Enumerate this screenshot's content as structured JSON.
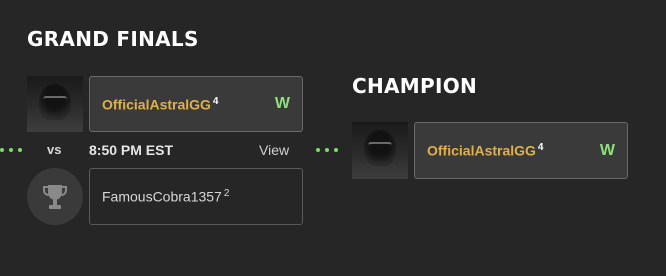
{
  "bracket": {
    "title": "GRAND FINALS",
    "champion_title": "CHAMPION"
  },
  "match": {
    "vs_label": "vs",
    "time": "8:50 PM EST",
    "view_label": "View",
    "top_player": {
      "name": "OfficialAstralGG",
      "seed": "4",
      "result": "W"
    },
    "bottom_player": {
      "name": "FamousCobra1357",
      "seed": "2"
    }
  },
  "champion": {
    "name": "OfficialAstralGG",
    "seed": "4",
    "result": "W"
  },
  "icons": {
    "placeholder": "trophy-icon",
    "connector": "dots-connector"
  },
  "colors": {
    "background": "#262626",
    "winner_name": "#e2b04a",
    "win_badge": "#8fe07a",
    "connector": "#7ddc6a",
    "slot_winner_bg": "#3a3a3a"
  }
}
